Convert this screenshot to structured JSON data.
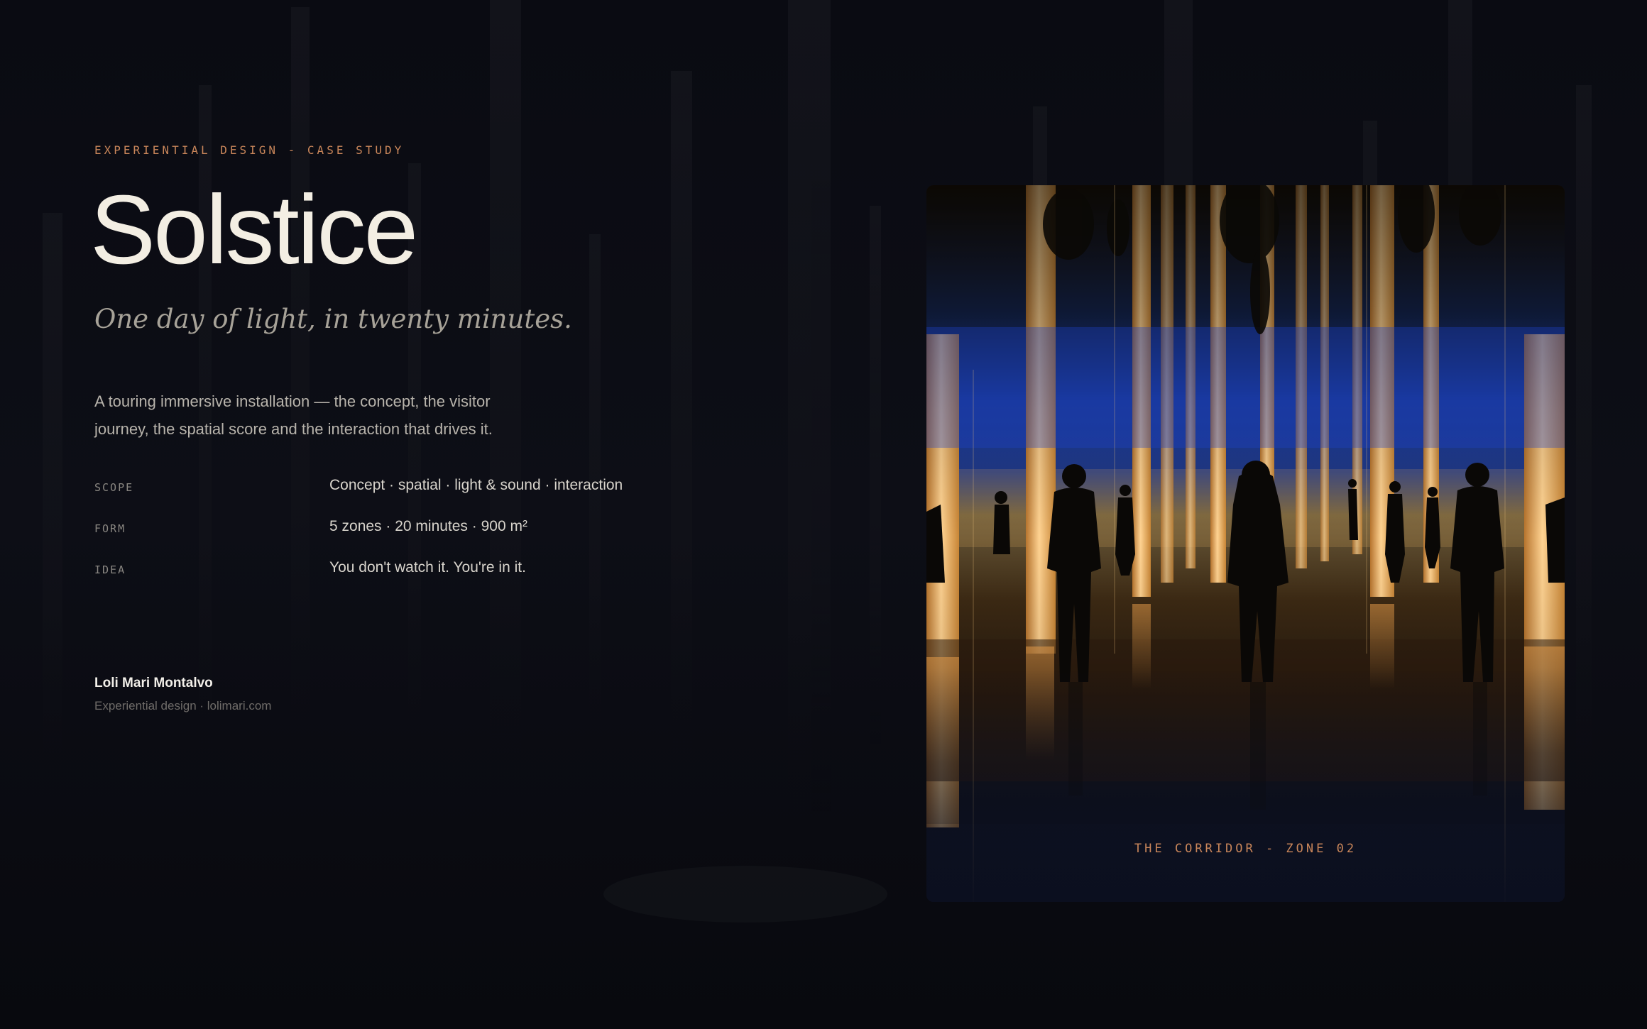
{
  "eyebrow": "EXPERIENTIAL DESIGN - CASE STUDY",
  "title": "Solstice",
  "tagline": "One day of light, in twenty minutes.",
  "intro": "A touring immersive installation — the concept, the visitor journey, the spatial score and the interaction that drives it.",
  "facts": [
    {
      "label": "SCOPE",
      "value": "Concept · spatial · light & sound · interaction"
    },
    {
      "label": "FORM",
      "value": "5 zones · 20 minutes · 900 m²"
    },
    {
      "label": "IDEA",
      "value": "You don't watch it. You're in it."
    }
  ],
  "author": {
    "name": "Loli Mari Montalvo",
    "subtitle": "Experiential design · lolimari.com"
  },
  "photo": {
    "caption": "THE CORRIDOR - ZONE 02",
    "subject": "people walking through a mirrored corridor of glowing amber light columns under blue light"
  },
  "colors": {
    "background": "#0a0b12",
    "accent": "#c9865a",
    "title": "#f3eee3",
    "amber_light": "#f2b35e",
    "blue_light": "#1f3fb0"
  }
}
